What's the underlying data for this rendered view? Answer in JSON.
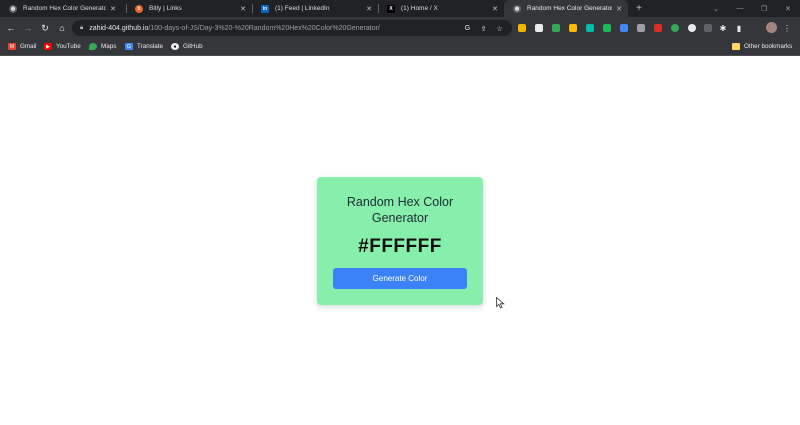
{
  "browser": {
    "tabs": [
      {
        "title": "Random Hex Color Generator",
        "icon": "globe-icon"
      },
      {
        "title": "Bitly | Links",
        "icon": "bitly-icon"
      },
      {
        "title": "(1) Feed | LinkedIn",
        "icon": "linkedin-icon"
      },
      {
        "title": "(1) Home / X",
        "icon": "x-icon"
      },
      {
        "title": "Random Hex Color Generator",
        "icon": "globe-icon"
      }
    ],
    "url_host": "zahid-404.github.io",
    "url_path": "/100-days-of-JS/Day-3%20-%20Random%20Hex%20Color%20Generator/",
    "bookmarks": [
      {
        "label": "Gmail",
        "icon": "gmail-icon"
      },
      {
        "label": "YouTube",
        "icon": "youtube-icon"
      },
      {
        "label": "Maps",
        "icon": "maps-icon"
      },
      {
        "label": "Translate",
        "icon": "translate-icon"
      },
      {
        "label": "GitHub",
        "icon": "github-icon"
      }
    ],
    "other_bookmarks": "Other bookmarks"
  },
  "page": {
    "title": "Random Hex Color Generator",
    "hex_value": "#FFFFFF",
    "button_label": "Generate Color",
    "card_color": "#86efac",
    "button_color": "#3b82f6",
    "background_color": "#FFFFFF"
  }
}
